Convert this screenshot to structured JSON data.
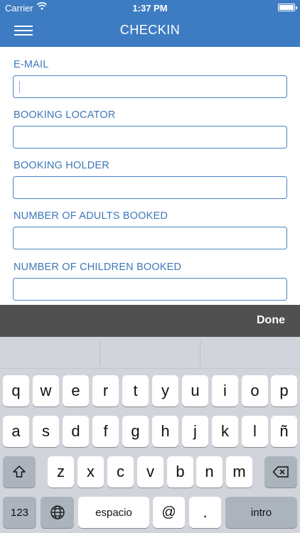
{
  "status_bar": {
    "carrier": "Carrier",
    "time": "1:37 PM",
    "battery_level": 1.0
  },
  "nav": {
    "title": "CHECKIN",
    "menu_icon": "hamburger-menu-icon"
  },
  "form": {
    "fields": [
      {
        "label": "E-MAIL",
        "value": ""
      },
      {
        "label": "BOOKING LOCATOR",
        "value": ""
      },
      {
        "label": "BOOKING HOLDER",
        "value": ""
      },
      {
        "label": "NUMBER OF ADULTS BOOKED",
        "value": ""
      },
      {
        "label": "NUMBER OF CHILDREN BOOKED",
        "value": ""
      }
    ]
  },
  "accessory": {
    "done_label": "Done"
  },
  "keyboard": {
    "row1": [
      "q",
      "w",
      "e",
      "r",
      "t",
      "y",
      "u",
      "i",
      "o",
      "p"
    ],
    "row2": [
      "a",
      "s",
      "d",
      "f",
      "g",
      "h",
      "j",
      "k",
      "l",
      "ñ"
    ],
    "row3": [
      "z",
      "x",
      "c",
      "v",
      "b",
      "n",
      "m"
    ],
    "shift_icon": "shift-icon",
    "delete_icon": "backspace-icon",
    "numbers_label": "123",
    "globe_icon": "globe-icon",
    "space_label": "espacio",
    "at_label": "@",
    "dot_label": ".",
    "return_label": "intro"
  },
  "colors": {
    "accent": "#3d7cc2",
    "label": "#3d78b8",
    "accessory_bar": "#505050",
    "keyboard_bg": "#d1d5db"
  }
}
